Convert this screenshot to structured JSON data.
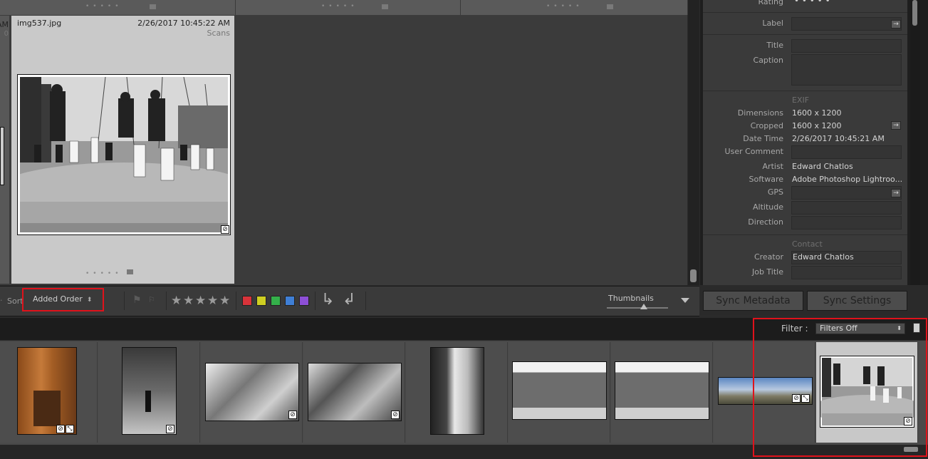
{
  "grid": {
    "selected": {
      "filename": "img537.jpg",
      "datetime": "2/26/2017 10:45:22 AM",
      "folder": "Scans"
    },
    "left_partial": {
      "a": "AM",
      "b": "0"
    }
  },
  "toolbar": {
    "sort_label": "Sort",
    "sort_value": "Added Order",
    "stars": [
      "★",
      "★",
      "★",
      "★",
      "★"
    ],
    "color_labels": [
      "#d8333a",
      "#cfcf22",
      "#34b04a",
      "#3f7fd6",
      "#8d4fd6"
    ],
    "thumbnails_label": "Thumbnails",
    "thumbnail_size": 0.55
  },
  "metadata": {
    "rating_label": "Rating",
    "rating_dots": "• • • • •",
    "label_label": "Label",
    "title_label": "Title",
    "caption_label": "Caption",
    "exif_header": "EXIF",
    "rows": [
      {
        "label": "Dimensions",
        "value": "1600 x 1200"
      },
      {
        "label": "Cropped",
        "value": "1600 x 1200"
      },
      {
        "label": "Date Time",
        "value": "2/26/2017 10:45:21 AM"
      },
      {
        "label": "User Comment",
        "value": ""
      },
      {
        "label": "Artist",
        "value": "Edward Chatlos"
      },
      {
        "label": "Software",
        "value": "Adobe Photoshop Lightroo..."
      },
      {
        "label": "GPS",
        "value": ""
      },
      {
        "label": "Altitude",
        "value": ""
      },
      {
        "label": "Direction",
        "value": ""
      }
    ],
    "contact_header": "Contact",
    "creator_label": "Creator",
    "creator_value": "Edward Chatlos",
    "job_title_label": "Job Title",
    "sync_metadata": "Sync Metadata",
    "sync_settings": "Sync Settings"
  },
  "filmstrip": {
    "filter_label": "Filter :",
    "filter_value": "Filters Off"
  }
}
